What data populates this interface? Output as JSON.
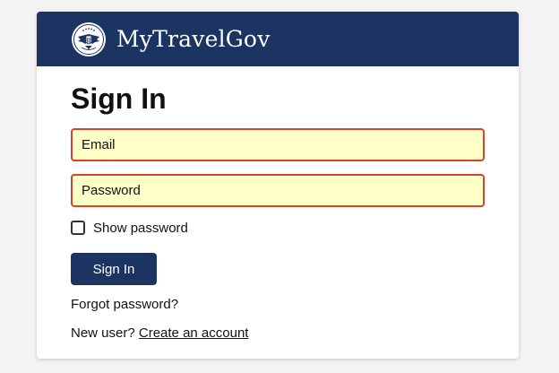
{
  "header": {
    "brand": "MyTravelGov",
    "seal_icon": "government-seal-icon",
    "background": "#1c3461"
  },
  "form": {
    "title": "Sign In",
    "email_placeholder": "Email",
    "password_placeholder": "Password",
    "show_password_label": "Show password",
    "show_password_checked": false,
    "submit_label": "Sign In",
    "forgot_label": "Forgot password?",
    "new_user_text": "New user?",
    "create_account_label": "Create an account"
  },
  "colors": {
    "accent": "#1c3461",
    "field_border_error": "#d8432e",
    "field_background": "#ffffc8"
  }
}
